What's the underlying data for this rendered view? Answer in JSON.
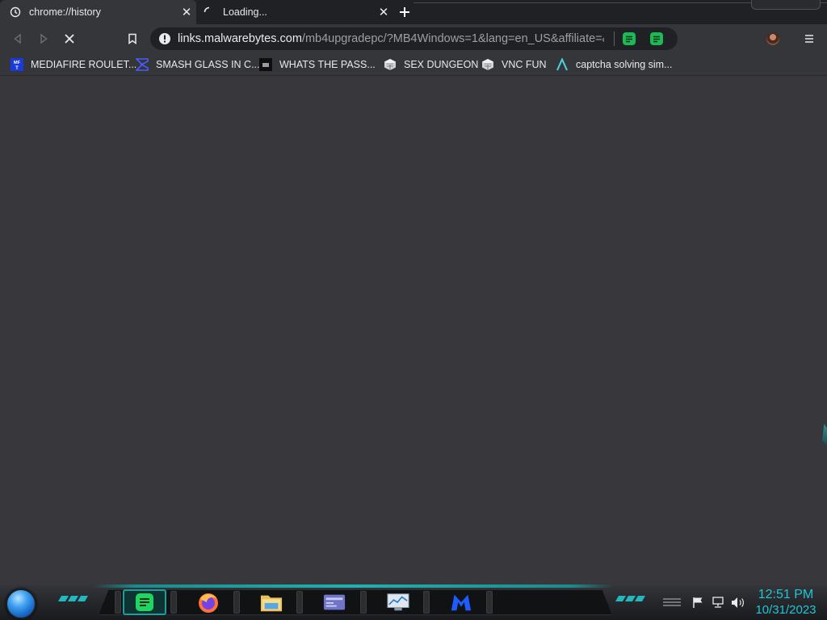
{
  "tabs": [
    {
      "title": "chrome://history",
      "icon": "history-icon",
      "active": true
    },
    {
      "title": "Loading...",
      "icon": "loading-spinner-icon",
      "active": false
    }
  ],
  "omnibox": {
    "url_host": "links.malwarebytes.com",
    "url_path": "/mb4upgradepc/?MB4Windows=1&lang=en_US&affiliate=&..."
  },
  "bookmarks": [
    {
      "label": "MEDIAFIRE ROULET...",
      "icon": "mediafire-icon"
    },
    {
      "label": "SMASH GLASS IN C...",
      "icon": "sigma-icon"
    },
    {
      "label": "WHATS THE PASS...",
      "icon": "dark-square-icon"
    },
    {
      "label": "SEX DUNGEON",
      "icon": "cube-icon"
    },
    {
      "label": "VNC FUN",
      "icon": "cube-icon"
    },
    {
      "label": "captcha solving sim...",
      "icon": "lambda-icon"
    }
  ],
  "taskbar": {
    "apps": [
      "notes-app-icon",
      "firefox-icon",
      "file-explorer-icon",
      "control-panel-icon",
      "resource-monitor-icon",
      "malwarebytes-icon"
    ]
  },
  "clock": {
    "time": "12:51 PM",
    "date": "10/31/2023"
  },
  "colors": {
    "page_background": "#38383c",
    "accent_teal": "#21c6d6",
    "extension_green": "#1db954"
  }
}
